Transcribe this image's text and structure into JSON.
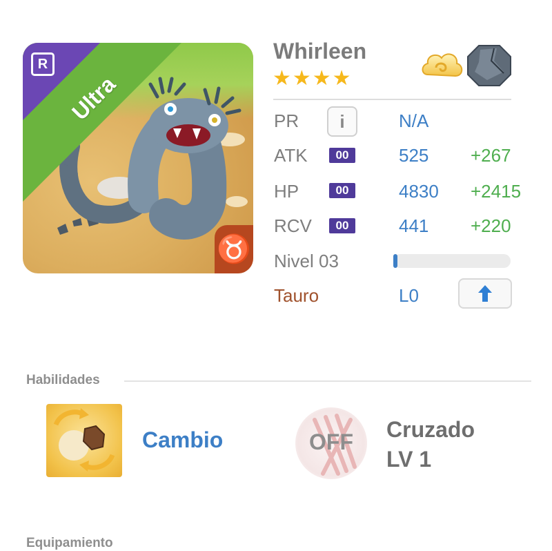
{
  "portrait": {
    "rarity_badge": "R",
    "rarity_ribbon": "Ultra",
    "zodiac_symbol": "♉",
    "colors": {
      "ribbon_green": "#6bb43e",
      "ribbon_purple": "#6b47b4",
      "zodiac_bg": "#b6471f"
    }
  },
  "header": {
    "name": "Whirleen",
    "stars": "★★★★",
    "star_count": 4,
    "element_icons": [
      "cloud-icon",
      "stone-icon"
    ]
  },
  "stats": {
    "pr": {
      "label": "PR",
      "value": "N/A"
    },
    "atk": {
      "label": "ATK",
      "chip": "00",
      "value": "525",
      "bonus": "+267"
    },
    "hp": {
      "label": "HP",
      "chip": "00",
      "value": "4830",
      "bonus": "+2415"
    },
    "rcv": {
      "label": "RCV",
      "chip": "00",
      "value": "441",
      "bonus": "+220"
    },
    "level": {
      "label": "Nivel 03",
      "progress_fraction": 0.02
    },
    "sign": {
      "label": "Tauro",
      "value": "L0"
    }
  },
  "abilities": {
    "heading": "Habilidades",
    "active": {
      "label": "Cambio"
    },
    "passive": {
      "status": "OFF",
      "name": "Cruzado",
      "level": "LV 1"
    }
  },
  "equipment": {
    "heading": "Equipamiento"
  },
  "colors": {
    "value_blue": "#3d7fc6",
    "bonus_green": "#4fae4f",
    "sign_brown": "#a0522d",
    "chip_purple": "#4f3a9a",
    "star_gold": "#f6b81c"
  }
}
